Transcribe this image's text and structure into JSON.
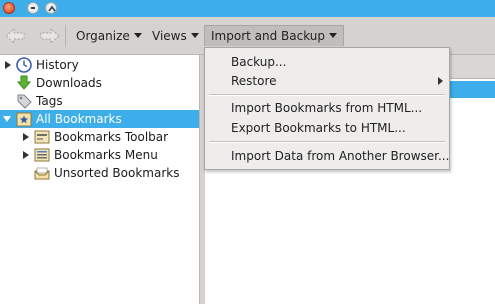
{
  "toolbar": {
    "organize_label": "Organize",
    "views_label": "Views",
    "import_backup_label": "Import and Backup"
  },
  "tree": {
    "items": [
      {
        "label": "History",
        "icon": "clock-icon",
        "expander": "collapsed"
      },
      {
        "label": "Downloads",
        "icon": "download-arrow-icon",
        "expander": "none"
      },
      {
        "label": "Tags",
        "icon": "tag-icon",
        "expander": "none"
      },
      {
        "label": "All Bookmarks",
        "icon": "star-folder-icon",
        "expander": "expanded",
        "selected": true
      },
      {
        "label": "Bookmarks Toolbar",
        "icon": "toolbar-folder-icon",
        "expander": "collapsed"
      },
      {
        "label": "Bookmarks Menu",
        "icon": "menu-folder-icon",
        "expander": "collapsed"
      },
      {
        "label": "Unsorted Bookmarks",
        "icon": "unsorted-folder-icon",
        "expander": "none"
      }
    ]
  },
  "import_menu": {
    "items": [
      {
        "label": "Backup...",
        "has_submenu": false
      },
      {
        "label": "Restore",
        "has_submenu": true
      },
      {
        "label": "Import Bookmarks from HTML...",
        "has_submenu": false
      },
      {
        "label": "Export Bookmarks to HTML...",
        "has_submenu": false
      },
      {
        "label": "Import Data from Another Browser...",
        "has_submenu": false
      }
    ]
  },
  "colors": {
    "titlebar": "#3daee9",
    "selection": "#3daee9",
    "toolbar_bg": "#d6d2d0",
    "menu_bg": "#efedec"
  }
}
